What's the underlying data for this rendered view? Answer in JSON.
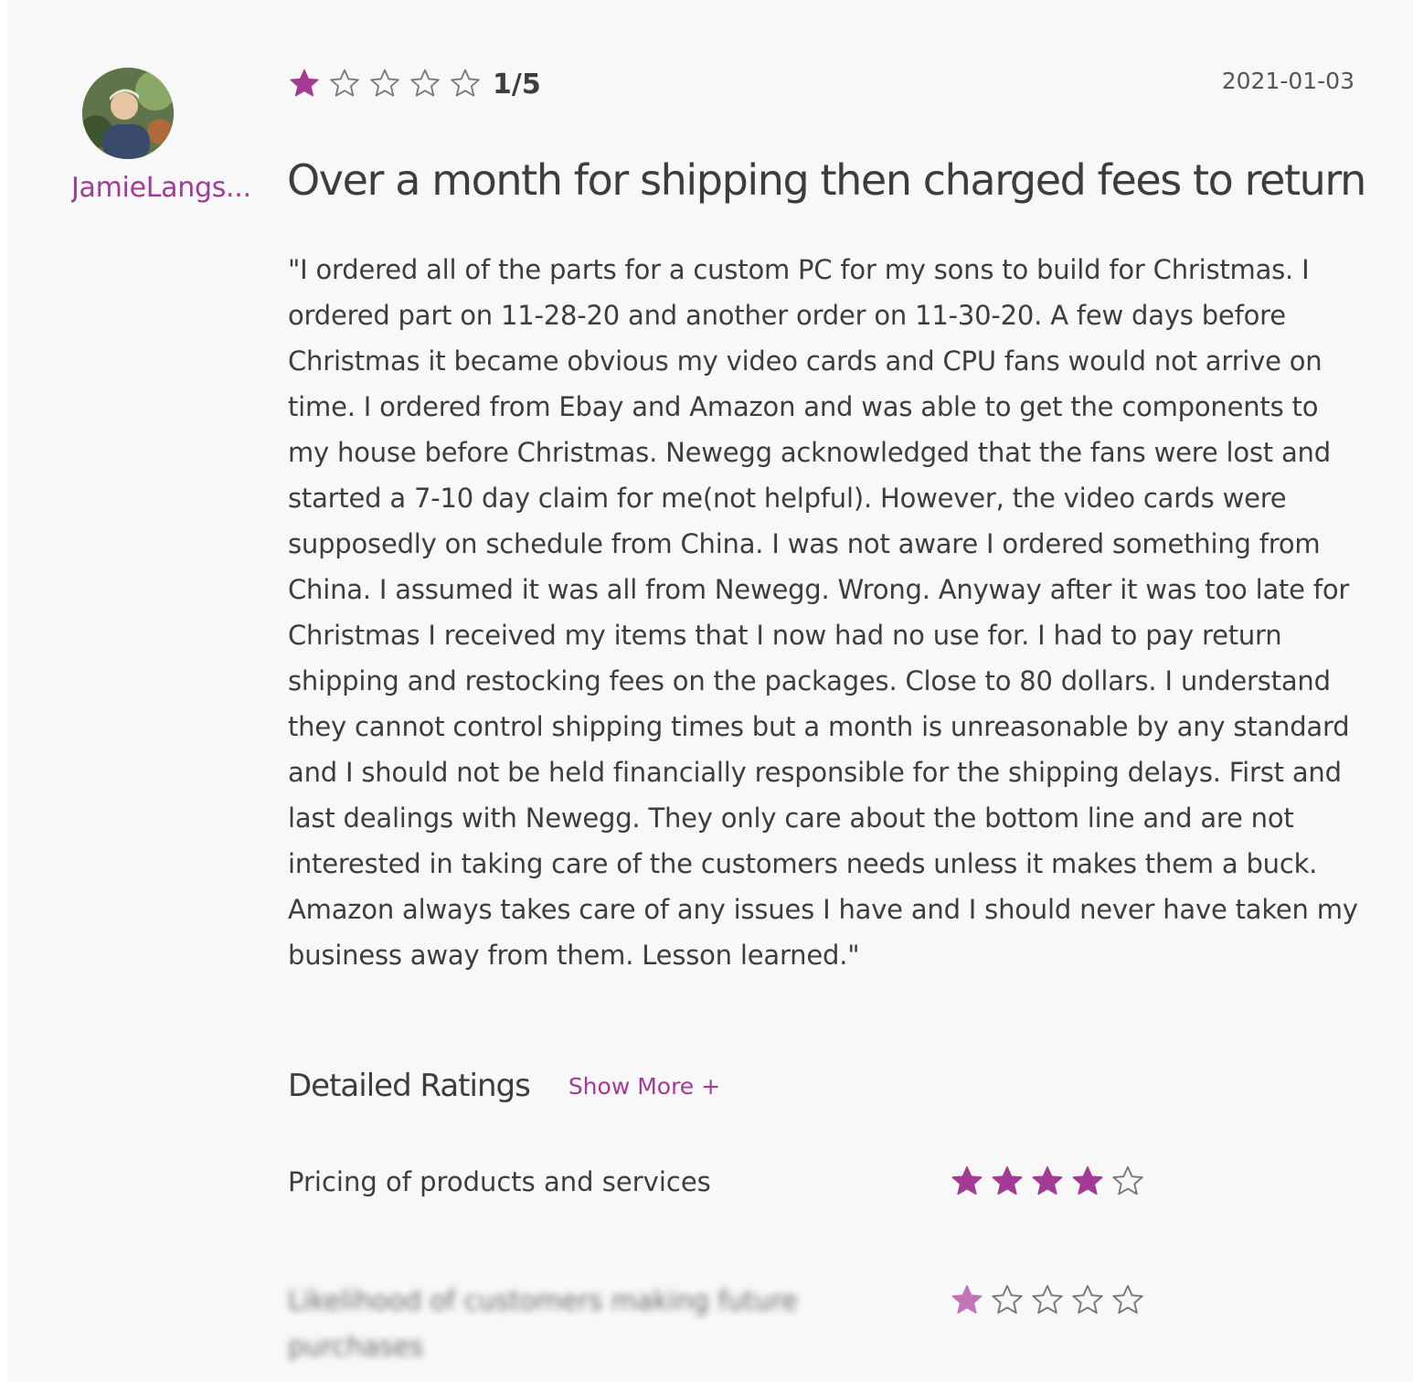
{
  "review": {
    "username": "JamieLangs...",
    "rating_text": "1/5",
    "rating_value": 1,
    "rating_max": 5,
    "date": "2021-01-03",
    "title": "Over a month for shipping then charged fees to return",
    "body": "\"I ordered all of the parts for a custom PC for my sons to build for Christmas. I ordered part on 11-28-20 and another order on 11-30-20. A few days before Christmas it became obvious my video cards and CPU fans would not arrive on time. I ordered from Ebay and Amazon and was able to get the components to my house before Christmas. Newegg acknowledged that the fans were lost and started a 7-10 day claim for me(not helpful). However, the video cards were supposedly on schedule from China. I was not aware I ordered something from China. I assumed it was all from Newegg. Wrong. Anyway after it was too late for Christmas I received my items that I now had no use for. I had to pay return shipping and restocking fees on the packages. Close to 80 dollars. I understand they cannot control shipping times but a month is unreasonable by any standard and I should not be held financially responsible for the shipping delays. First and last dealings with Newegg. They only care about the bottom line and are not interested in taking care of the customers needs unless it makes them a buck. Amazon always takes care of any issues I have and I should never have taken my business away from them. Lesson learned.\""
  },
  "detailed": {
    "title": "Detailed Ratings",
    "show_more": "Show More +",
    "items": [
      {
        "label": "Pricing of products and services",
        "rating": 4,
        "max": 5
      },
      {
        "label": "Likelihood of customers making future purchases",
        "rating": 1,
        "max": 5
      }
    ]
  },
  "icons": {
    "star_filled": "star-filled-icon",
    "star_empty": "star-empty-icon"
  },
  "colors": {
    "accent": "#a23a96",
    "text": "#3d3d3d",
    "background": "#f8f8f8",
    "star_outline": "#777777"
  }
}
